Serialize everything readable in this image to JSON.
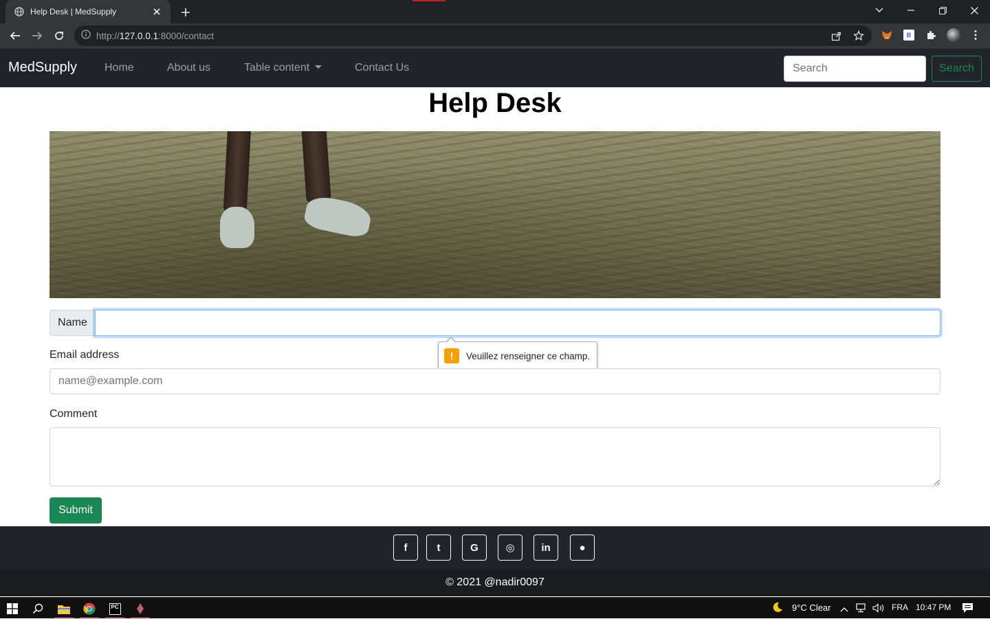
{
  "browser": {
    "tab_title": "Help Desk | MedSupply",
    "url_scheme": "http://",
    "url_host": "127.0.0.1",
    "url_rest": ":8000/contact"
  },
  "navbar": {
    "brand": "MedSupply",
    "links": [
      "Home",
      "About us",
      "Table content",
      "Contact Us"
    ],
    "search_placeholder": "Search",
    "search_button": "Search"
  },
  "page": {
    "title": "Help Desk",
    "name_label": "Name",
    "email_label": "Email address",
    "email_placeholder": "name@example.com",
    "comment_label": "Comment",
    "submit_label": "Submit",
    "validation_message": "Veuillez renseigner ce champ."
  },
  "footer": {
    "social": [
      "facebook-icon",
      "twitter-icon",
      "google-icon",
      "instagram-icon",
      "linkedin-icon",
      "github-icon"
    ],
    "social_glyphs": [
      "f",
      "t",
      "G",
      "◎",
      "in",
      "●"
    ],
    "copyright": "© 2021 @nadir0097"
  },
  "taskbar": {
    "weather": "9°C  Clear",
    "language": "FRA",
    "time": "10:47 PM"
  },
  "colors": {
    "success": "#198754",
    "navbar": "#212529",
    "focus_border": "#86b7fe"
  }
}
